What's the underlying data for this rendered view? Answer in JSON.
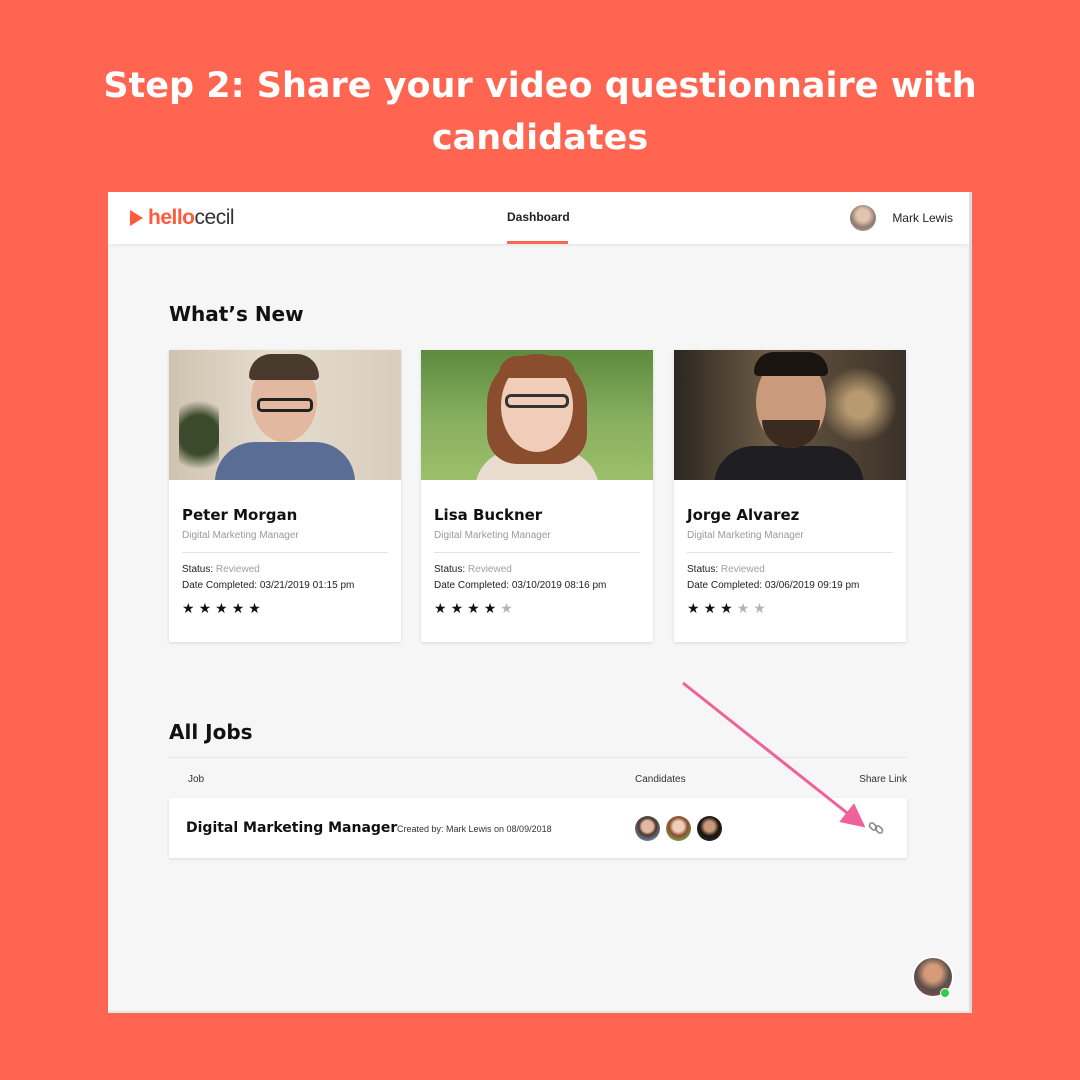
{
  "headline": {
    "line1": "Step 2:  Share your video questionnaire with",
    "line2": "candidates"
  },
  "app": {
    "logo_part1": "hello",
    "logo_part2": "cecil",
    "nav_active": "Dashboard",
    "user_name": "Mark Lewis"
  },
  "whats_new": {
    "title": "What’s New",
    "cards": [
      {
        "name": "Peter Morgan",
        "role": "Digital Marketing Manager",
        "status_label": "Status:",
        "status": "Reviewed",
        "date": "Date Completed: 03/21/2019 01:15 pm",
        "rating": 5
      },
      {
        "name": "Lisa Buckner",
        "role": "Digital Marketing Manager",
        "status_label": "Status:",
        "status": "Reviewed",
        "date": "Date Completed: 03/10/2019 08:16 pm",
        "rating": 4
      },
      {
        "name": "Jorge Alvarez",
        "role": "Digital Marketing Manager",
        "status_label": "Status:",
        "status": "Reviewed",
        "date": "Date Completed: 03/06/2019 09:19 pm",
        "rating": 3
      }
    ]
  },
  "all_jobs": {
    "title": "All Jobs",
    "columns": {
      "job": "Job",
      "candidates": "Candidates",
      "share": "Share Link"
    },
    "rows": [
      {
        "title": "Digital Marketing Manager",
        "meta": "Created by: Mark Lewis on 08/09/2018"
      }
    ]
  },
  "colors": {
    "accent": "#ff6550",
    "arrow": "#f0609a"
  },
  "icons": [
    "play-logo-icon",
    "link-icon",
    "chat-avatar-icon",
    "arrow-annotation"
  ]
}
